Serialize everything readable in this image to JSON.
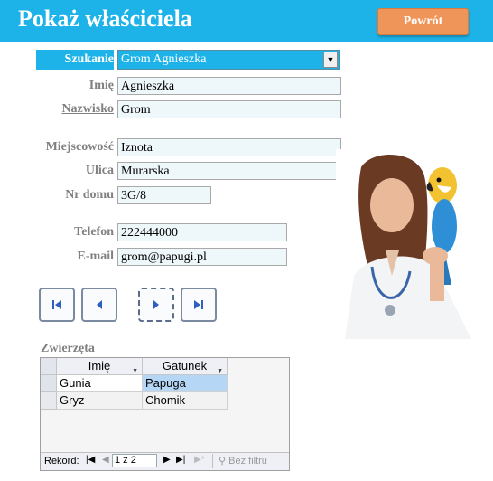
{
  "header": {
    "title": "Pokaż właściciela",
    "back_label": "Powrót"
  },
  "search": {
    "label": "Szukanie",
    "value": "Grom Agnieszka"
  },
  "fields": {
    "imie_label": "Imię",
    "imie_value": "Agnieszka",
    "nazwisko_label": "Nazwisko",
    "nazwisko_value": "Grom",
    "miejscowosc_label": "Miejscowość",
    "miejscowosc_value": "Iznota",
    "ulica_label": "Ulica",
    "ulica_value": "Murarska",
    "nrdomu_label": "Nr domu",
    "nrdomu_value": "3G/8",
    "telefon_label": "Telefon",
    "telefon_value": "222444000",
    "email_label": "E-mail",
    "email_value": "grom@papugi.pl"
  },
  "nav": {
    "icons": [
      "first-record-icon",
      "prev-record-icon",
      "next-record-icon",
      "last-record-icon"
    ]
  },
  "subform": {
    "label": "Zwierzęta",
    "columns": [
      "Imię",
      "Gatunek"
    ],
    "rows": [
      [
        "Gunia",
        "Papuga"
      ],
      [
        "Gryz",
        "Chomik"
      ]
    ],
    "status": {
      "rekord_label": "Rekord:",
      "position": "1 z 2",
      "filter_label": "Bez filtru"
    }
  },
  "colors": {
    "header": "#1db3e9",
    "button": "#f0955a",
    "field_bg": "#eef7fa"
  }
}
